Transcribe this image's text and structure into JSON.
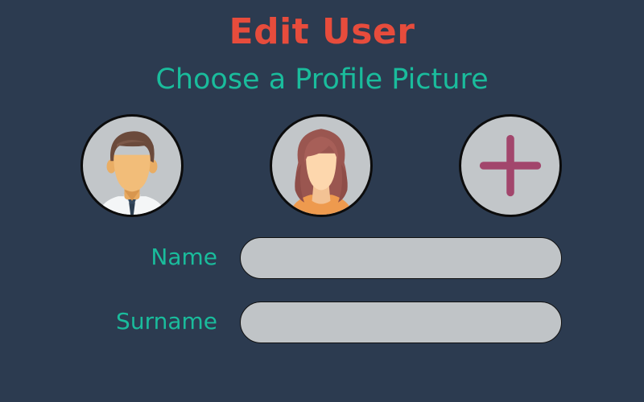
{
  "header": {
    "title": "Edit User",
    "subtitle": "Choose a Profile Picture"
  },
  "avatars": [
    {
      "icon": "male-avatar-icon"
    },
    {
      "icon": "female-avatar-icon"
    },
    {
      "icon": "plus-icon"
    }
  ],
  "form": {
    "name_label": "Name",
    "name_value": "",
    "surname_label": "Surname",
    "surname_value": ""
  },
  "colors": {
    "background": "#2c3b50",
    "title": "#e74c3c",
    "accent": "#1abc9c",
    "input_fill": "#c0c4c7",
    "plus": "#a2466c"
  }
}
